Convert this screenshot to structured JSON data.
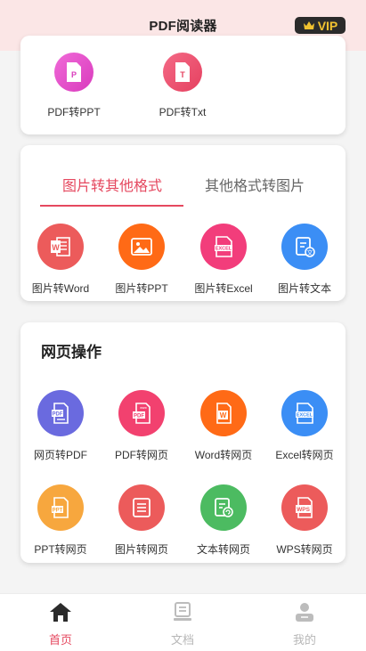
{
  "header": {
    "title": "PDF阅读器",
    "vip_label": "VIP"
  },
  "top_card": {
    "items": [
      {
        "label": "PDF转PPT",
        "icon": "ppt-file-icon",
        "glyph": "P",
        "color": "#e34fc8"
      },
      {
        "label": "PDF转Txt",
        "icon": "txt-file-icon",
        "glyph": "T",
        "color": "#f0506e"
      }
    ]
  },
  "image_card": {
    "tabs": [
      {
        "label": "图片转其他格式",
        "active": true
      },
      {
        "label": "其他格式转图片",
        "active": false
      }
    ],
    "items": [
      {
        "label": "图片转Word",
        "icon": "word-icon",
        "color": "#ec5b5b"
      },
      {
        "label": "图片转PPT",
        "icon": "image-icon",
        "color": "#ff6a16"
      },
      {
        "label": "图片转Excel",
        "icon": "excel-icon",
        "color": "#f23d7b"
      },
      {
        "label": "图片转文本",
        "icon": "text-doc-icon",
        "color": "#3b8ef5"
      }
    ]
  },
  "web_card": {
    "title": "网页操作",
    "items": [
      {
        "label": "网页转PDF",
        "icon": "pdf-icon",
        "color": "#6a6adf"
      },
      {
        "label": "PDF转网页",
        "icon": "pdf-icon",
        "color": "#f2416f"
      },
      {
        "label": "Word转网页",
        "icon": "word-icon",
        "color": "#ff6a16"
      },
      {
        "label": "Excel转网页",
        "icon": "excel-icon",
        "color": "#3b8ef5"
      },
      {
        "label": "PPT转网页",
        "icon": "ppt-icon",
        "color": "#f7a73e"
      },
      {
        "label": "图片转网页",
        "icon": "image-doc-icon",
        "color": "#ec5b5b"
      },
      {
        "label": "文本转网页",
        "icon": "text-refresh-icon",
        "color": "#4cbb61"
      },
      {
        "label": "WPS转网页",
        "icon": "wps-icon",
        "color": "#ec5b5b"
      }
    ]
  },
  "bottom_nav": {
    "items": [
      {
        "label": "首页",
        "icon": "home-icon",
        "active": true
      },
      {
        "label": "文档",
        "icon": "document-icon",
        "active": false
      },
      {
        "label": "我的",
        "icon": "profile-icon",
        "active": false
      }
    ]
  },
  "colors": {
    "accent": "#e5485f",
    "header_bg": "#fbe6e6",
    "vip_gold": "#f2c230"
  }
}
